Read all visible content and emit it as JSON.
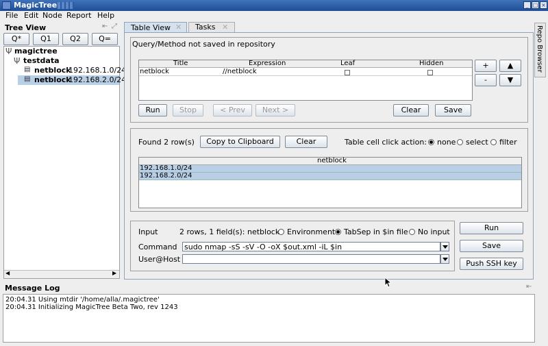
{
  "window": {
    "title": "MagicTree"
  },
  "menubar": {
    "items": [
      "File",
      "Edit",
      "Node",
      "Report",
      "Help"
    ]
  },
  "tree_view": {
    "title": "Tree View",
    "query_buttons": [
      "Q*",
      "Q1",
      "Q2",
      "Q="
    ],
    "root": "magictree",
    "folder": "testdata",
    "nodes": [
      {
        "type": "netblock",
        "value": "192.168.1.0/24"
      },
      {
        "type": "netblock",
        "value": "192.168.2.0/24"
      }
    ]
  },
  "tabs": {
    "table_view": "Table View",
    "tasks": "Tasks"
  },
  "side_tab": "Repo Browser",
  "query": {
    "status": "Query/Method not saved in repository",
    "columns": [
      "Title",
      "Expression",
      "Leaf",
      "Hidden"
    ],
    "row": {
      "title": "netblock",
      "expression": "//netblock"
    },
    "buttons": {
      "run": "Run",
      "stop": "Stop",
      "prev": "< Prev",
      "next": "Next >",
      "clear": "Clear",
      "save": "Save"
    },
    "side_buttons": [
      "+",
      "-"
    ]
  },
  "results": {
    "found": "Found 2 row(s)",
    "copy": "Copy to Clipboard",
    "clear": "Clear",
    "click_action_label": "Table cell click action:",
    "click_action_options": [
      "none",
      "select",
      "filter"
    ],
    "click_action_selected": "none",
    "column": "netblock",
    "rows": [
      "192.168.1.0/24",
      "192.168.2.0/24"
    ]
  },
  "command": {
    "input_label": "Input",
    "input_summary": "2 rows, 1 field(s): netblock",
    "input_options": [
      "Environment",
      "TabSep in $in file",
      "No input"
    ],
    "input_selected": "TabSep in $in file",
    "command_label": "Command",
    "command_value": "sudo nmap -sS -sV -O -oX $out.xml -iL $in",
    "userhost_label": "User@Host",
    "userhost_value": "",
    "run": "Run",
    "save": "Save",
    "push": "Push SSH key"
  },
  "message_log": {
    "title": "Message Log",
    "lines": [
      "20:04.31 Using mtdir '/home/alla/.magictree'",
      "20:04.31 Initializing MagicTree Beta Two, rev 1243"
    ]
  },
  "colors": {
    "titlebar": "#2f62ab",
    "selection": "#b8cfe5",
    "accent": "#1f4f97"
  }
}
